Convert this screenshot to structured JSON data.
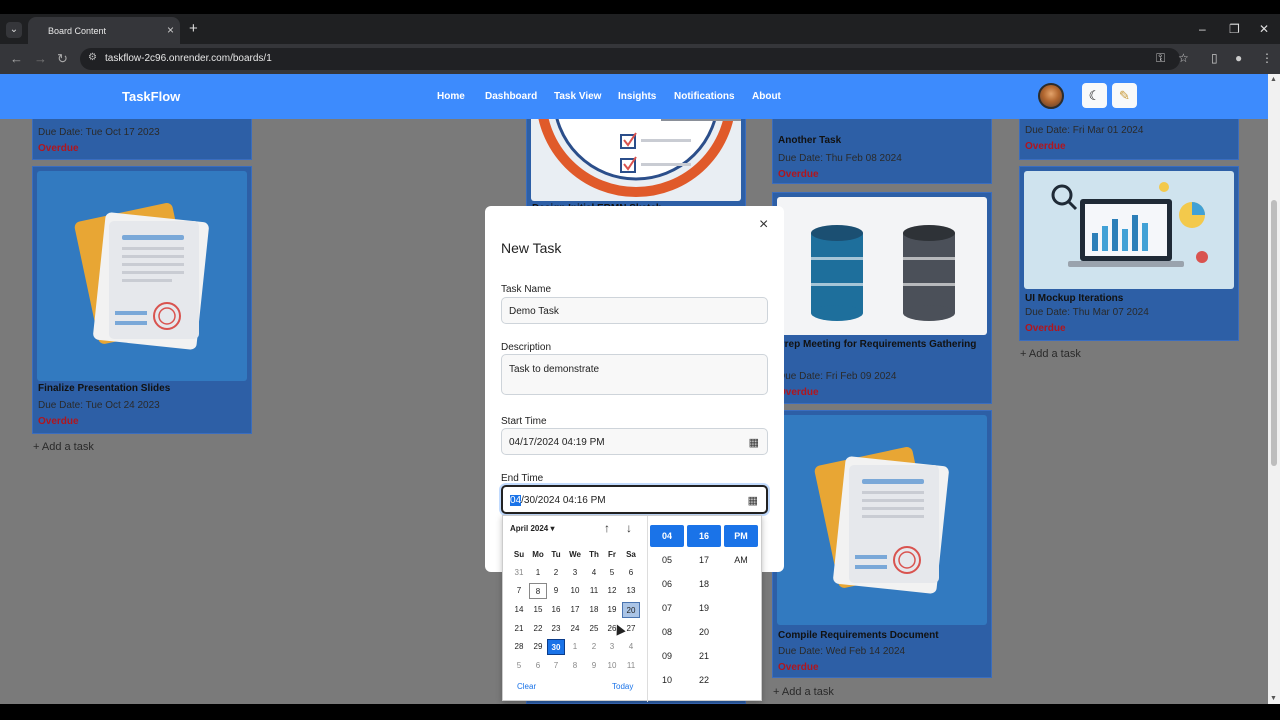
{
  "browser": {
    "tab_title": "Board Content",
    "url": "taskflow-2c96.onrender.com/boards/1"
  },
  "nav": {
    "brand": "TaskFlow",
    "links": [
      "Home",
      "Dashboard",
      "Task View",
      "Insights",
      "Notifications",
      "About"
    ]
  },
  "board": {
    "col1": {
      "card1": {
        "date": "Due Date: Tue Oct 17 2023",
        "status": "Overdue"
      },
      "card2": {
        "title": "Finalize Presentation Slides",
        "date": "Due Date: Tue Oct 24 2023",
        "status": "Overdue"
      },
      "add": "+ Add a task"
    },
    "col2": {
      "card1": {
        "title": "Design Initial ERMN Sketch"
      }
    },
    "col3": {
      "card1": {
        "title": "Another Task",
        "date": "Due Date: Thu Feb 08 2024",
        "status": "Overdue"
      },
      "card2": {
        "title": "Prep Meeting for Requirements Gathering",
        "date": "Due Date: Fri Feb 09 2024",
        "status": "Overdue"
      },
      "card3": {
        "title": "Compile Requirements Document",
        "date": "Due Date: Wed Feb 14 2024",
        "status": "Overdue"
      },
      "add": "+ Add a task"
    },
    "col4": {
      "card1": {
        "date": "Due Date: Fri Mar 01 2024",
        "status": "Overdue"
      },
      "card2": {
        "title": "UI Mockup Iterations",
        "date": "Due Date: Thu Mar 07 2024",
        "status": "Overdue"
      },
      "add": "+ Add a task"
    }
  },
  "modal": {
    "title": "New Task",
    "close": "×",
    "task_name_label": "Task Name",
    "task_name_value": "Demo Task",
    "description_label": "Description",
    "description_value": "Task to demonstrate",
    "start_label": "Start Time",
    "start_value": "04/17/2024 04:19 PM",
    "end_label": "End Time",
    "end_month": "04",
    "end_rest": "/30/2024 04:16 PM"
  },
  "picker": {
    "month": "April 2024",
    "weekdays": [
      "Su",
      "Mo",
      "Tu",
      "We",
      "Th",
      "Fr",
      "Sa"
    ],
    "weeks": [
      [
        "31",
        "1",
        "2",
        "3",
        "4",
        "5",
        "6"
      ],
      [
        "7",
        "8",
        "9",
        "10",
        "11",
        "12",
        "13"
      ],
      [
        "14",
        "15",
        "16",
        "17",
        "18",
        "19",
        "20"
      ],
      [
        "21",
        "22",
        "23",
        "24",
        "25",
        "26",
        "27"
      ],
      [
        "28",
        "29",
        "30",
        "1",
        "2",
        "3",
        "4"
      ],
      [
        "5",
        "6",
        "7",
        "8",
        "9",
        "10",
        "11"
      ]
    ],
    "clear": "Clear",
    "today": "Today",
    "hours": [
      "04",
      "05",
      "06",
      "07",
      "08",
      "09",
      "10"
    ],
    "minutes": [
      "16",
      "17",
      "18",
      "19",
      "20",
      "21",
      "22"
    ],
    "ampm": [
      "PM",
      "AM"
    ]
  },
  "colors": {
    "navbar": "#3d8bfd",
    "card": "#2d5fa6",
    "overdue": "#b0161e",
    "accent": "#1a73e8"
  },
  "icons": [
    "chevron-down-icon",
    "plus-icon",
    "back-icon",
    "forward-icon",
    "reload-icon",
    "site-info-icon",
    "key-icon",
    "star-icon",
    "sidebar-icon",
    "profile-icon",
    "more-icon",
    "moon-icon",
    "brush-icon",
    "close-icon",
    "calendar-icon",
    "arrow-up-icon",
    "arrow-down-icon"
  ]
}
